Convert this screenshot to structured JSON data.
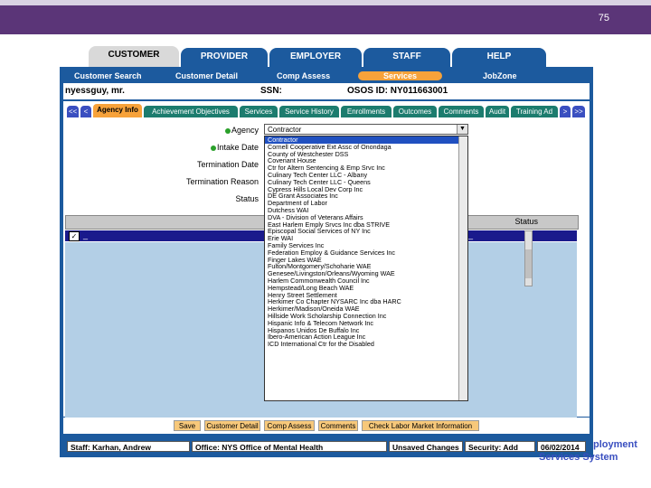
{
  "slide": {
    "number": "75"
  },
  "top_tabs": [
    "CUSTOMER",
    "PROVIDER",
    "EMPLOYER",
    "STAFF",
    "HELP"
  ],
  "subnav": [
    "Customer Search",
    "Customer Detail",
    "Comp Assess",
    "Services",
    "JobZone"
  ],
  "info": {
    "customer": "nyessguy, mr.",
    "ssn_label": "SSN:",
    "osos_id": "OSOS ID: NY011663001"
  },
  "inner_tabs": [
    "<<",
    "<",
    "Agency Info",
    "Achievement Objectives",
    "Services",
    "Service History",
    "Enrollments",
    "Outcomes",
    "Comments",
    "Audit",
    "Training Ad",
    ">",
    ">>"
  ],
  "form": {
    "agency_label": "Agency",
    "intake_label": "Intake Date",
    "termination_label": "Termination Date",
    "termination_reason_label": "Termination Reason",
    "status_label": "Status",
    "agency_value": "Contractor"
  },
  "grid": {
    "status_header": "Status",
    "row_check": "✓",
    "row_cell1": "_",
    "row_cell2": "_"
  },
  "dropdown_options": [
    "Contractor",
    "Cornell Cooperative Ext Assc of Onondaga",
    "County of Westchester DSS",
    "Covenant House",
    "Ctr for Altern Sentencing & Emp Srvc Inc",
    "Culinary Tech Center LLC - Albany",
    "Culinary Tech Center LLC - Queens",
    "Cypress Hills Local Dev Corp Inc",
    "DE Grant Associates Inc",
    "Department of Labor",
    "Dutchess WAI",
    "DVA - Division of Veterans Affairs",
    "East Harlem Emply Srvcs Inc dba STRIVE",
    "Episcopal Social Services of NY Inc",
    "Erie WAI",
    "Family Services Inc",
    "Federation Employ & Guidance Services Inc",
    "Finger Lakes WAE",
    "Fulton/Montgomery/Schoharie WAE",
    "Genesee/Livingston/Orleans/Wyoming WAE",
    "Harlem Commonwealth Council Inc",
    "Hempstead/Long Beach WAE",
    "Henry Street Settlement",
    "Herkimer Co Chapter NYSARC Inc dba HARC",
    "Herkimer/Madison/Oneida WAE",
    "Hillside Work Scholarship Connection Inc",
    "Hispanic Info & Telecom Network Inc",
    "Hispanos Unidos De Buffalo Inc",
    "Ibero-American Action League Inc",
    "ICD International Ctr for the Disabled"
  ],
  "buttons": [
    "Save",
    "Customer Detail",
    "Comp Assess",
    "Comments",
    "Check Labor Market Information"
  ],
  "statusbar": {
    "staff": "Staff: Karhan, Andrew",
    "office": "Office: NYS Office of Mental Health",
    "unsaved": "Unsaved Changes",
    "security": "Security: Add",
    "date": "06/02/2014"
  },
  "logo": {
    "line1": "ployment",
    "line2": "Services System"
  },
  "colors": {
    "header_purple": "#5b3578",
    "app_blue": "#1c5a9e",
    "accent_orange": "#f7a23a",
    "tab_teal": "#1c7c6e",
    "grid_blue": "#b3cfe6"
  }
}
